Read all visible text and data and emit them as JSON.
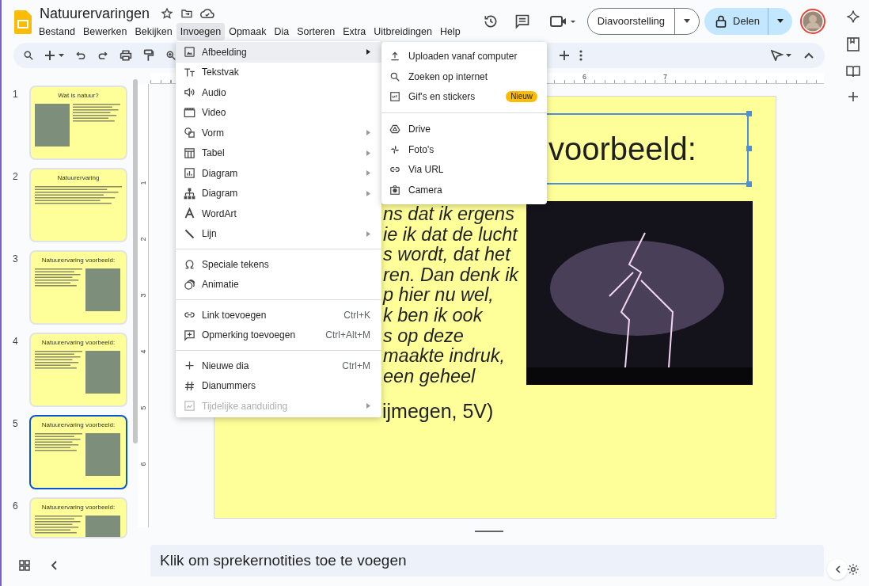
{
  "document": {
    "title": "Natuurervaringen"
  },
  "menu_bar": [
    {
      "label": "Bestand",
      "selected": false
    },
    {
      "label": "Bewerken",
      "selected": false
    },
    {
      "label": "Bekijken",
      "selected": false
    },
    {
      "label": "Invoegen",
      "selected": true
    },
    {
      "label": "Opmaak",
      "selected": false
    },
    {
      "label": "Dia",
      "selected": false
    },
    {
      "label": "Sorteren",
      "selected": false
    },
    {
      "label": "Extra",
      "selected": false
    },
    {
      "label": "Uitbreidingen",
      "selected": false
    },
    {
      "label": "Help",
      "selected": false
    }
  ],
  "slideshow_button": {
    "label": "Diavoorstelling"
  },
  "share_button": {
    "label": "Delen"
  },
  "slides": [
    {
      "number": "1",
      "title": "Wat is natuur?",
      "kind": "image-left",
      "selected": false
    },
    {
      "number": "2",
      "title": "Natuurervaring",
      "kind": "text-only",
      "selected": false
    },
    {
      "number": "3",
      "title": "Natuurervaring voorbeeld:",
      "kind": "image-right",
      "selected": false
    },
    {
      "number": "4",
      "title": "Natuurervaring voorbeeld:",
      "kind": "image-right",
      "selected": false
    },
    {
      "number": "5",
      "title": "Natuurervaring voorbeeld:",
      "kind": "image-right",
      "selected": true
    },
    {
      "number": "6",
      "title": "Natuurervaring voorbeeld:",
      "kind": "image-right",
      "selected": false
    }
  ],
  "ruler": {
    "horizontal_labels": [
      "6",
      "7"
    ],
    "vertical_labels": [
      "1",
      "2",
      "3",
      "4",
      "5",
      "6"
    ]
  },
  "slide": {
    "title": "voorbeeld:",
    "body_lines": [
      "ns dat ik ergens",
      "ie ik dat de lucht",
      "s wordt, dat het",
      "ren. Dan denk ik",
      "p hier nu wel,",
      "k ben ik ook",
      "s op deze",
      "maakte indruk,",
      "een geheel"
    ],
    "source": "ijmegen, 5V)"
  },
  "insert_menu": {
    "groups": [
      [
        {
          "label": "Afbeelding",
          "submenu": true,
          "selected": true,
          "disabled": false
        },
        {
          "label": "Tekstvak",
          "submenu": false,
          "selected": false,
          "disabled": false
        },
        {
          "label": "Audio",
          "submenu": false,
          "selected": false,
          "disabled": false
        },
        {
          "label": "Video",
          "submenu": false,
          "selected": false,
          "disabled": false
        },
        {
          "label": "Vorm",
          "submenu": true,
          "selected": false,
          "disabled": false
        },
        {
          "label": "Tabel",
          "submenu": true,
          "selected": false,
          "disabled": false
        },
        {
          "label": "Diagram",
          "submenu": true,
          "selected": false,
          "disabled": false
        },
        {
          "label": "Diagram",
          "submenu": true,
          "selected": false,
          "disabled": false
        },
        {
          "label": "WordArt",
          "submenu": false,
          "selected": false,
          "disabled": false
        },
        {
          "label": "Lijn",
          "submenu": true,
          "selected": false,
          "disabled": false
        }
      ],
      [
        {
          "label": "Speciale tekens",
          "submenu": false,
          "selected": false,
          "disabled": false
        },
        {
          "label": "Animatie",
          "submenu": false,
          "selected": false,
          "disabled": false
        }
      ],
      [
        {
          "label": "Link toevoegen",
          "shortcut": "Ctrl+K",
          "submenu": false,
          "selected": false,
          "disabled": false
        },
        {
          "label": "Opmerking toevoegen",
          "shortcut": "Ctrl+Alt+M",
          "submenu": false,
          "selected": false,
          "disabled": false
        }
      ],
      [
        {
          "label": "Nieuwe dia",
          "shortcut": "Ctrl+M",
          "submenu": false,
          "selected": false,
          "disabled": false
        },
        {
          "label": "Dianummers",
          "submenu": false,
          "selected": false,
          "disabled": false
        },
        {
          "label": "Tijdelijke aanduiding",
          "submenu": true,
          "selected": false,
          "disabled": true
        }
      ]
    ]
  },
  "image_submenu": {
    "groups": [
      [
        {
          "label": "Uploaden vanaf computer"
        },
        {
          "label": "Zoeken op internet"
        },
        {
          "label": "Gif's en stickers",
          "badge": "Nieuw"
        }
      ],
      [
        {
          "label": "Drive"
        },
        {
          "label": "Foto's"
        },
        {
          "label": "Via URL"
        },
        {
          "label": "Camera"
        }
      ]
    ]
  },
  "speaker_notes": {
    "placeholder": "Klik om sprekernotities toe te voegen"
  }
}
